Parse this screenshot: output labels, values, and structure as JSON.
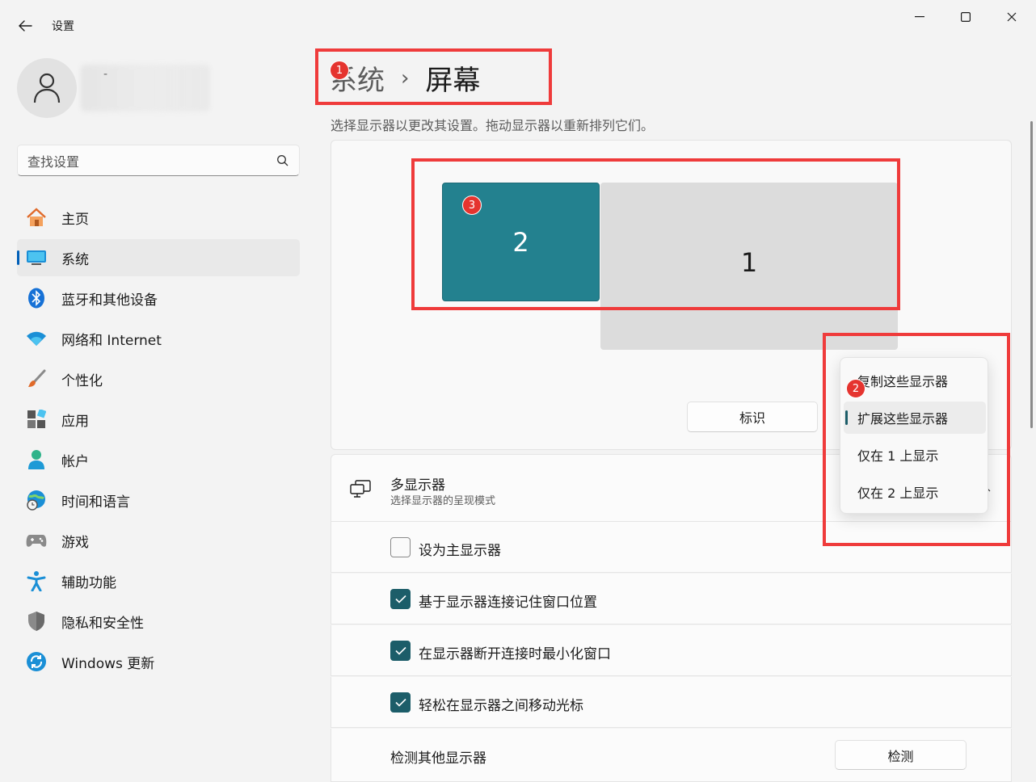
{
  "window": {
    "title": "设置",
    "controls": {
      "minimize": "minimize-icon",
      "maximize": "maximize-icon",
      "close": "close-icon"
    }
  },
  "profile": {
    "name_placeholder": "-"
  },
  "search": {
    "placeholder": "查找设置"
  },
  "sidebar": {
    "items": [
      {
        "label": "主页",
        "icon": "home-icon"
      },
      {
        "label": "系统",
        "icon": "system-icon",
        "active": true
      },
      {
        "label": "蓝牙和其他设备",
        "icon": "bluetooth-icon"
      },
      {
        "label": "网络和 Internet",
        "icon": "wifi-icon"
      },
      {
        "label": "个性化",
        "icon": "brush-icon"
      },
      {
        "label": "应用",
        "icon": "apps-icon"
      },
      {
        "label": "帐户",
        "icon": "account-icon"
      },
      {
        "label": "时间和语言",
        "icon": "globe-clock-icon"
      },
      {
        "label": "游戏",
        "icon": "gamepad-icon"
      },
      {
        "label": "辅助功能",
        "icon": "accessibility-icon"
      },
      {
        "label": "隐私和安全性",
        "icon": "shield-icon"
      },
      {
        "label": "Windows 更新",
        "icon": "update-icon"
      }
    ]
  },
  "breadcrumb": {
    "parent": "系统",
    "separator": "›",
    "current": "屏幕"
  },
  "subtitle": "选择显示器以更改其设置。拖动显示器以重新排列它们。",
  "displays": {
    "monitor_2": "2",
    "monitor_1": "1"
  },
  "identify_button": "标识",
  "dropdown": {
    "options": [
      "复制这些显示器",
      "扩展这些显示器",
      "仅在 1 上显示",
      "仅在 2 上显示"
    ],
    "selected": "扩展这些显示器"
  },
  "multi_display": {
    "title": "多显示器",
    "description": "选择显示器的呈现模式",
    "options": [
      {
        "label": "设为主显示器",
        "checked": false
      },
      {
        "label": "基于显示器连接记住窗口位置",
        "checked": true
      },
      {
        "label": "在显示器断开连接时最小化窗口",
        "checked": true
      },
      {
        "label": "轻松在显示器之间移动光标",
        "checked": true
      }
    ],
    "detect_label": "检测其他显示器",
    "detect_button": "检测"
  },
  "annotations": {
    "badge_1": "1",
    "badge_2": "2",
    "badge_3": "3"
  },
  "colors": {
    "accent": "#005fb8",
    "checkbox_accent": "#1c5d69",
    "monitor_selected": "#23818f",
    "annotation": "#ef3b3b"
  }
}
